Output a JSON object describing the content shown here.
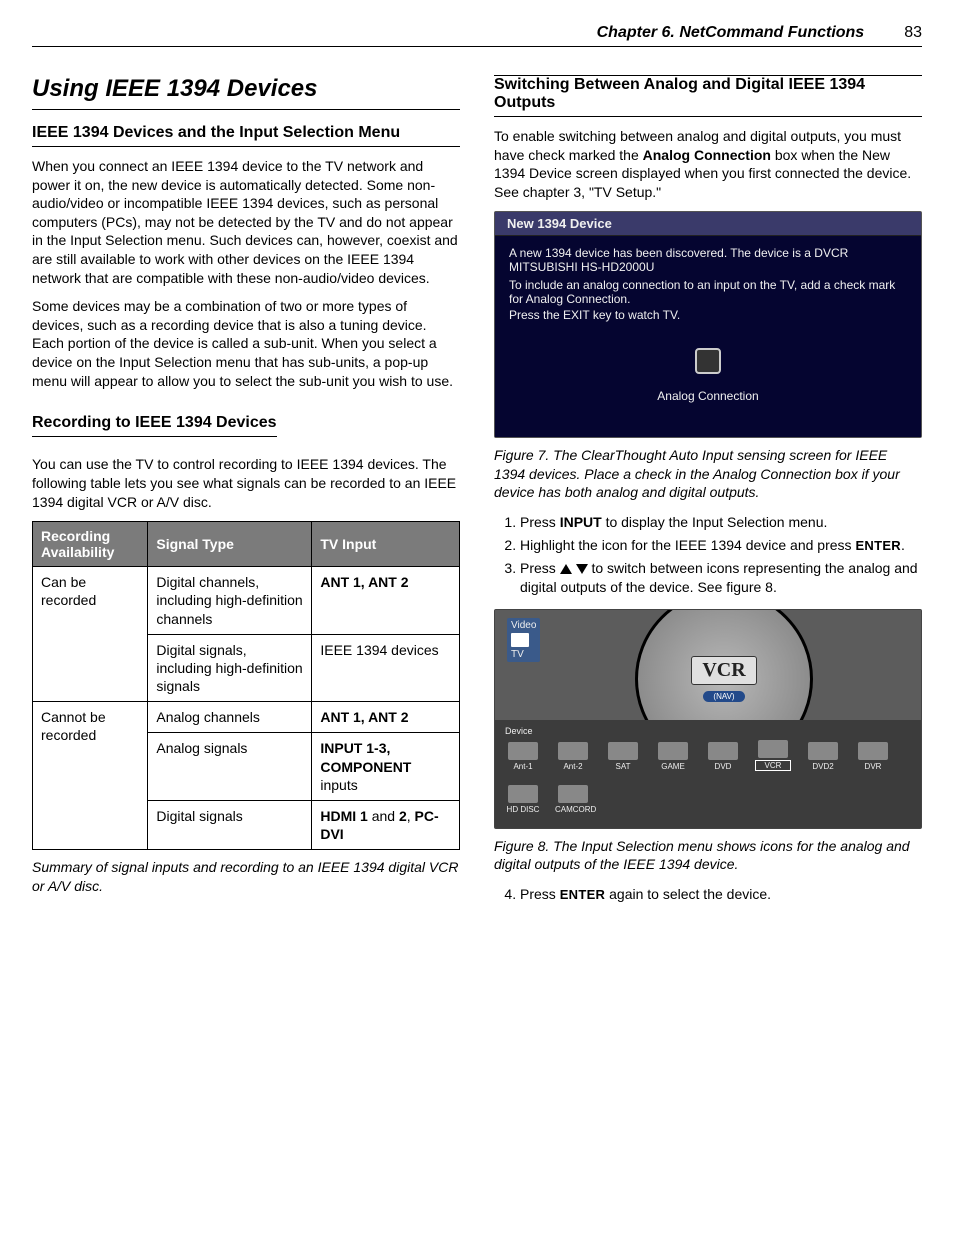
{
  "header": {
    "chapter": "Chapter 6.  NetCommand Functions",
    "page": "83"
  },
  "left": {
    "title": "Using IEEE 1394 Devices",
    "sub1": "IEEE 1394 Devices and the Input Selection Menu",
    "p1": "When you connect an IEEE 1394 device to the TV network and power it on, the new device is automatically detected. Some non-audio/video or incompatible IEEE 1394 devices, such as personal computers (PCs), may not be detected by the TV and do not appear in the Input Selection menu. Such devices can, however, coexist and are still available to work with other devices on the IEEE 1394 network that are compatible with these non-audio/video devices.",
    "p2": "Some devices may be a combination of two or more types of devices, such as a recording device that is also a tuning device.  Each portion of the device is called a sub-unit. When you select a device on the Input Selection menu that has sub-units, a pop-up menu will appear to allow you to select the sub-unit you wish to use.",
    "sub2": "Recording to IEEE 1394 Devices",
    "p3": "You can use the TV to control recording to IEEE 1394 devices.  The following table lets you see what signals can be recorded to an IEEE 1394 digital VCR or A/V disc.",
    "table": {
      "h1": "Recording Availability",
      "h2": "Signal Type",
      "h3": "TV Input",
      "r1c1": "Can be recorded",
      "r1c2": "Digital channels, including high-definition channels",
      "r1c3": "ANT 1, ANT 2",
      "r2c2": "Digital signals, including high-definition signals",
      "r2c3": "IEEE 1394 devices",
      "r3c1": "Cannot be recorded",
      "r3c2": "Analog channels",
      "r3c3": "ANT 1, ANT 2",
      "r4c2": "Analog signals",
      "r4c3a": "INPUT 1-3, COMPONENT",
      "r4c3b": " inputs",
      "r5c2": "Digital signals",
      "r5c3a": "HDMI 1",
      "r5c3b": " and ",
      "r5c3c": "2",
      "r5c3d": ", ",
      "r5c3e": "PC-DVI"
    },
    "table_caption": "Summary of signal inputs and recording to an IEEE 1394 digital VCR or A/V disc."
  },
  "right": {
    "sub1": "Switching Between Analog and Digital IEEE 1394 Outputs",
    "p1a": "To enable switching between analog and digital outputs, you must have check marked the ",
    "p1b": "Analog Connection",
    "p1c": " box when the New 1394 Device screen displayed when you first connected the device.  See chapter 3, \"TV Setup.\"",
    "fig7": {
      "title": "New 1394 Device",
      "line1": "A new 1394 device has been discovered. The device is a DVCR MITSUBISHI HS-HD2000U",
      "line2": "To include an analog connection to an input on the TV, add a check mark for Analog Connection.",
      "line3": "Press the EXIT key to watch TV.",
      "checklabel": "Analog Connection"
    },
    "fig7_caption": "Figure 7.  The ClearThought Auto Input sensing screen for IEEE 1394 devices.  Place a check in the Analog Connection box if your device has both analog and digital outputs.",
    "step1a": "Press ",
    "step1b": "INPUT",
    "step1c": " to display the Input Selection menu.",
    "step2a": "Highlight the icon for the IEEE 1394 device and press ",
    "step2b": "ENTER",
    "step2c": ".",
    "step3a": "Press ",
    "step3b": " to switch between icons representing the analog and digital outputs of the device.  See figure 8.",
    "fig8": {
      "videolabel": "Video",
      "tv": "TV",
      "vcr": "VCR",
      "navy": "(NAV)",
      "device": "Device",
      "devs": [
        "Ant-1",
        "Ant-2",
        "SAT",
        "GAME",
        "DVD",
        "VCR",
        "DVD2",
        "DVR",
        "HD DISC",
        "CAMCORD"
      ],
      "highlight": "VCR"
    },
    "fig8_caption": "Figure 8.  The Input Selection menu shows icons for the analog and digital outputs of the IEEE 1394 device.",
    "step4a": "Press ",
    "step4b": "ENTER",
    "step4c": " again to select the device."
  }
}
